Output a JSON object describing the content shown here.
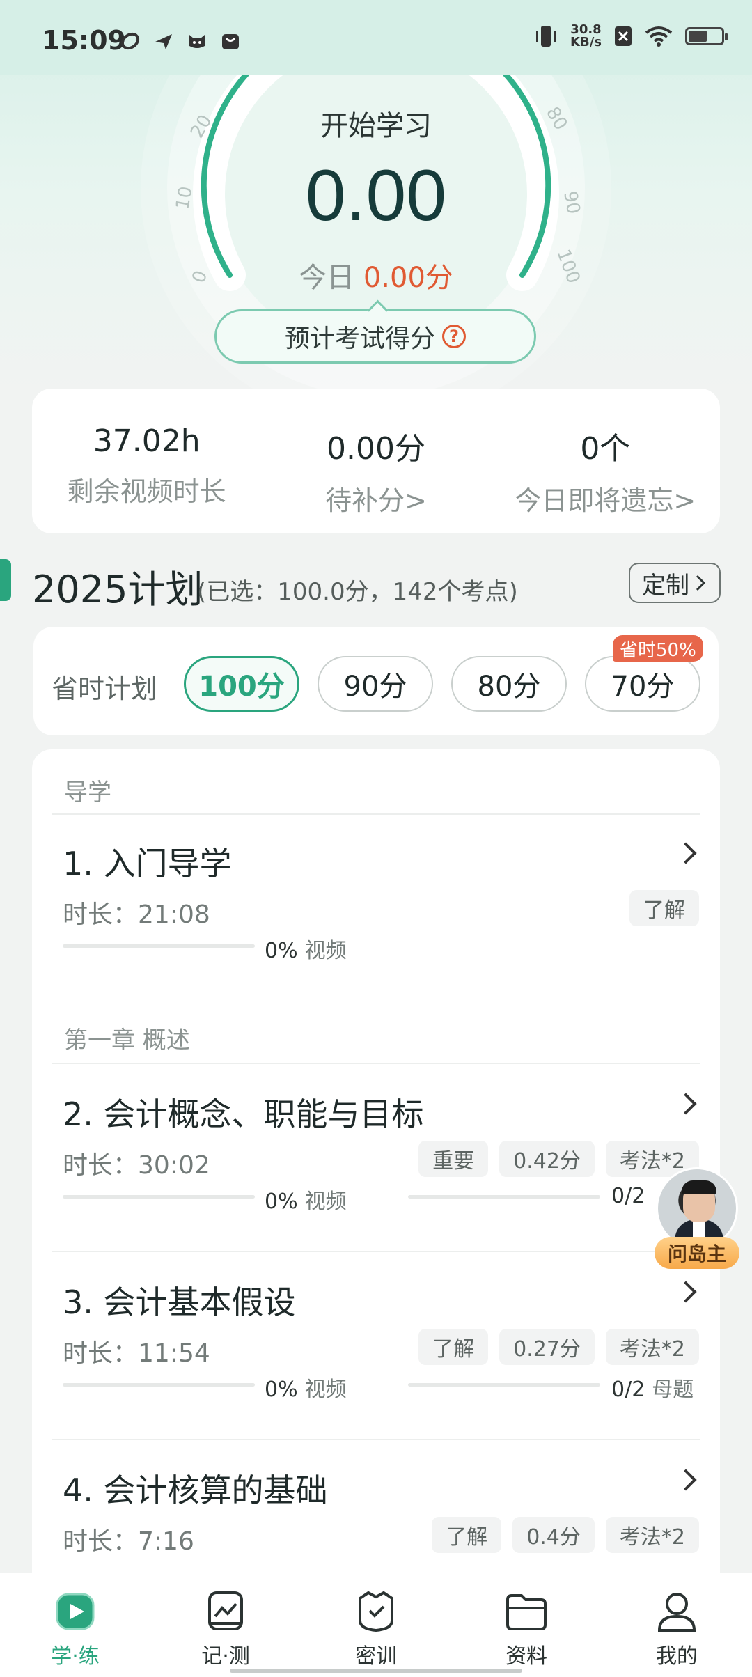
{
  "status_bar": {
    "time": "15:09",
    "net_speed_value": "30.8",
    "net_speed_unit": "KB/s"
  },
  "gauge": {
    "title": "开始学习",
    "score": "0.00",
    "today_prefix": "今日",
    "today_value": "0.00分",
    "ticks": [
      "0",
      "10",
      "20",
      "80",
      "90",
      "100"
    ],
    "predict_button": "预计考试得分",
    "help_symbol": "?"
  },
  "stats": [
    {
      "value": "37.02h",
      "label": "剩余视频时长"
    },
    {
      "value": "0.00分",
      "label": "待补分>"
    },
    {
      "value": "0个",
      "label": "今日即将遗忘>"
    }
  ],
  "plan": {
    "title": "2025计划",
    "subtitle": "(已选：100.0分，142个考点)",
    "custom_button": "定制"
  },
  "time_saving": {
    "label": "省时计划",
    "options": [
      "100分",
      "90分",
      "80分",
      "70分"
    ],
    "selected_index": 0,
    "badge": "省时50%"
  },
  "sections": [
    {
      "title": "导学"
    },
    {
      "title": "第一章 概述"
    }
  ],
  "items": [
    {
      "title": "1. 入门导学",
      "duration": "时长：21:08",
      "tags": [
        "了解"
      ],
      "video_progress": "0%",
      "video_label": "视频"
    },
    {
      "title": "2. 会计概念、职能与目标",
      "duration": "时长：30:02",
      "tags": [
        "重要",
        "0.42分",
        "考法*2"
      ],
      "video_progress": "0%",
      "video_label": "视频",
      "question_progress": "0/2",
      "question_label": ""
    },
    {
      "title": "3. 会计基本假设",
      "duration": "时长：11:54",
      "tags": [
        "了解",
        "0.27分",
        "考法*2"
      ],
      "video_progress": "0%",
      "video_label": "视频",
      "question_progress": "0/2",
      "question_label": "母题"
    },
    {
      "title": "4. 会计核算的基础",
      "duration": "时长：7:16",
      "tags": [
        "了解",
        "0.4分",
        "考法*2"
      ]
    }
  ],
  "helper": {
    "label": "问岛主"
  },
  "nav": [
    {
      "label": "学·练",
      "icon": "play-icon"
    },
    {
      "label": "记·测",
      "icon": "chart-icon"
    },
    {
      "label": "密训",
      "icon": "shield-icon"
    },
    {
      "label": "资料",
      "icon": "folder-icon"
    },
    {
      "label": "我的",
      "icon": "user-icon"
    }
  ],
  "colors": {
    "accent": "#2aa57e",
    "highlight": "#e05a33"
  }
}
